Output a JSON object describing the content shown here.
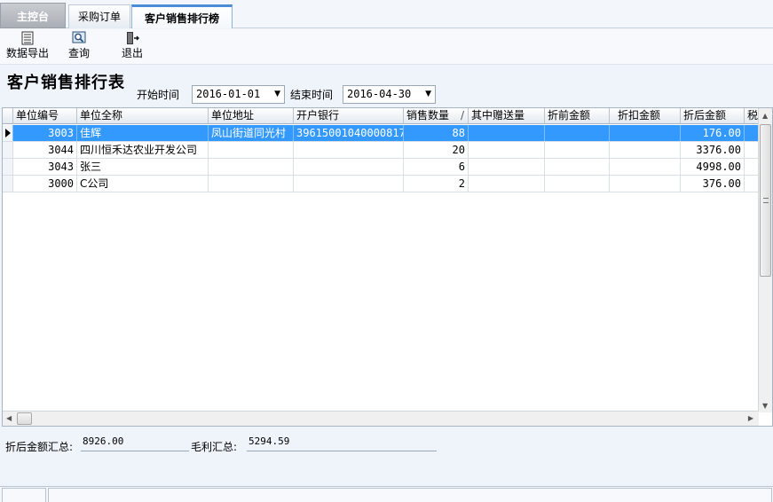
{
  "tabs": [
    {
      "label": "主控台"
    },
    {
      "label": "采购订单"
    },
    {
      "label": "客户销售排行榜"
    }
  ],
  "toolbar": {
    "export_label": "数据导出",
    "query_label": "查询",
    "exit_label": "退出"
  },
  "page": {
    "title": "客户销售排行表"
  },
  "filters": {
    "start_label": "开始时间",
    "start_value": "2016-01-01",
    "end_label": "结束时间",
    "end_value": "2016-04-30"
  },
  "table": {
    "columns": [
      "单位编号",
      "单位全称",
      "单位地址",
      "开户银行",
      "销售数量",
      "其中赠送量",
      "折前金额",
      "折扣金额",
      "折后金额",
      "税"
    ],
    "sort_indicator": "/",
    "rows": [
      {
        "code": "3003",
        "name": "佳辉",
        "address": "凤山街道同光村",
        "bank": "39615001040000817",
        "qty": "88",
        "gift": "",
        "before": "",
        "discount": "",
        "after": "176.00",
        "selected": true
      },
      {
        "code": "3044",
        "name": "四川恒禾达农业开发公司",
        "address": "",
        "bank": "",
        "qty": "20",
        "gift": "",
        "before": "",
        "discount": "",
        "after": "3376.00",
        "selected": false
      },
      {
        "code": "3043",
        "name": "张三",
        "address": "",
        "bank": "",
        "qty": "6",
        "gift": "",
        "before": "",
        "discount": "",
        "after": "4998.00",
        "selected": false
      },
      {
        "code": "3000",
        "name": "C公司",
        "address": "",
        "bank": "",
        "qty": "2",
        "gift": "",
        "before": "",
        "discount": "",
        "after": "376.00",
        "selected": false
      }
    ]
  },
  "summary": {
    "after_total_label": "折后金额汇总:",
    "after_total_value": "8926.00",
    "profit_total_label": "毛利汇总:",
    "profit_total_value": "5294.59"
  },
  "colors": {
    "selection": "#3399ff",
    "active_tab_accent": "#4a8cd6",
    "background": "#eef4fa"
  }
}
